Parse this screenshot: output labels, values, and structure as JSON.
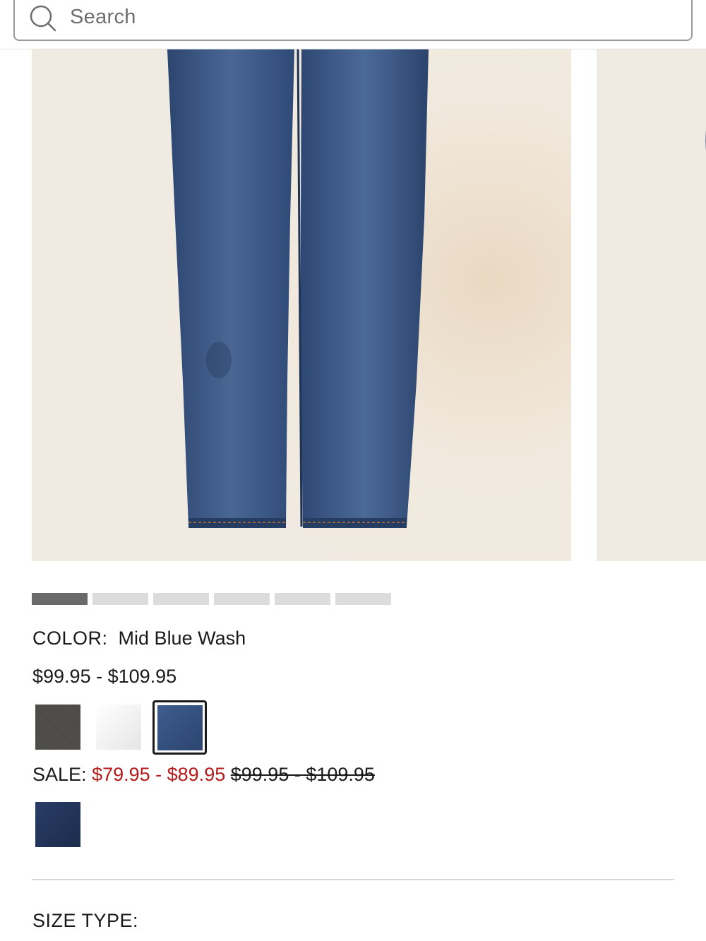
{
  "search": {
    "placeholder": "Search"
  },
  "product": {
    "images_count": 6,
    "active_image_index": 0,
    "color_label": "COLOR:",
    "color_value": "Mid Blue Wash",
    "price_range": "$99.95 - $109.95",
    "swatches": [
      {
        "name": "charcoal",
        "color": "#4a4844",
        "selected": false
      },
      {
        "name": "white",
        "color": "#f1f1f1",
        "selected": false
      },
      {
        "name": "mid-blue-wash",
        "color": "#34507f",
        "selected": true
      }
    ],
    "sale": {
      "label": "SALE:",
      "sale_price": "$79.95 - $89.95",
      "original_price": "$99.95 - $109.95",
      "swatches": [
        {
          "name": "dark-blue",
          "color": "#223459"
        }
      ]
    },
    "size_type_label": "SIZE TYPE:"
  },
  "colors": {
    "sale_red": "#b41a1a",
    "pager_active": "#6a6a6a",
    "pager_inactive": "#dcdcdc",
    "denim": "#34507f",
    "wall": "#f1ebe0"
  }
}
